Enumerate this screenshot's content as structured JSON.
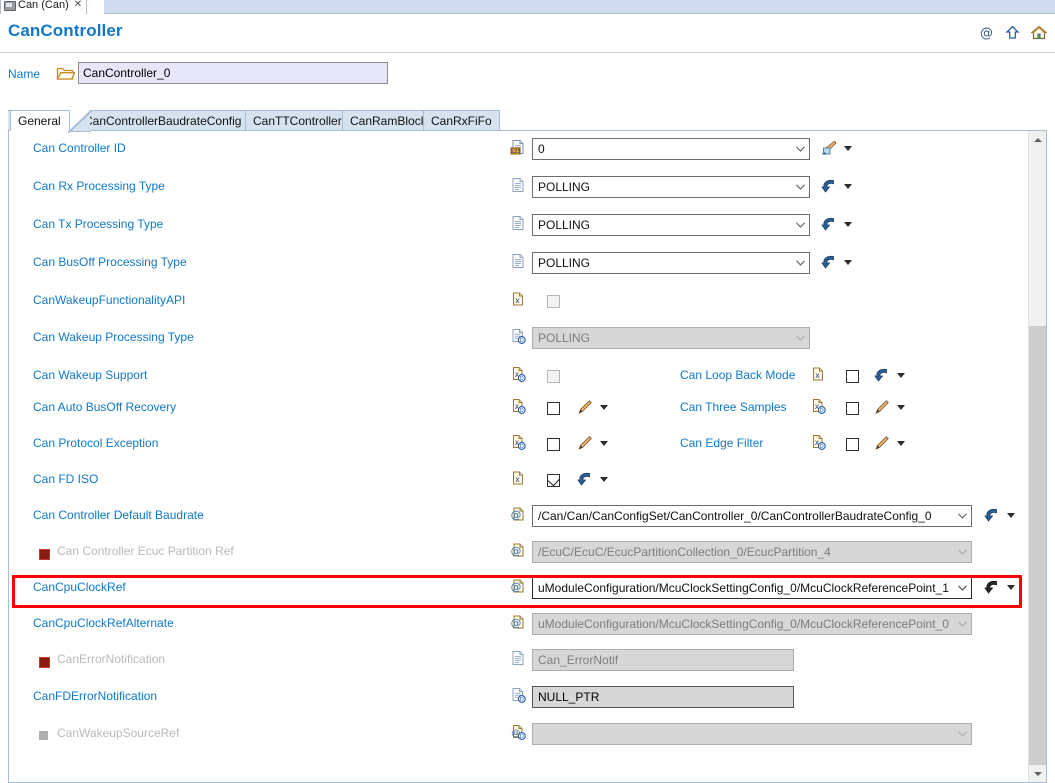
{
  "editor_tab": {
    "label": "Can (Can)",
    "close": "✕"
  },
  "header": {
    "title": "CanController",
    "icons": [
      "at-icon",
      "up-arrow-icon",
      "home-icon"
    ]
  },
  "name_row": {
    "label": "Name",
    "folder_icon": "folder-icon",
    "value": "CanController_0"
  },
  "tabs": [
    {
      "label": "General",
      "active": true
    },
    {
      "label": "CanControllerBaudrateConfig",
      "active": false
    },
    {
      "label": "CanTTController",
      "active": false
    },
    {
      "label": "CanRamBlock",
      "active": false
    },
    {
      "label": "CanRxFiFo",
      "active": false
    }
  ],
  "rows": [
    {
      "label": "Can Controller ID",
      "icon": "doc-numeric-icon",
      "control": "combo",
      "value": "0",
      "disabled": false,
      "action_icon": "paint-icon",
      "caret": true
    },
    {
      "label": "Can Rx Processing Type",
      "icon": "doc-icon",
      "control": "combo",
      "value": "POLLING",
      "disabled": false,
      "action_icon": "blue-arrow-icon",
      "caret": true
    },
    {
      "label": "Can Tx Processing Type",
      "icon": "doc-icon",
      "control": "combo",
      "value": "POLLING",
      "disabled": false,
      "action_icon": "blue-arrow-icon",
      "caret": true
    },
    {
      "label": "Can BusOff Processing Type",
      "icon": "doc-icon",
      "control": "combo",
      "value": "POLLING",
      "disabled": false,
      "action_icon": "blue-arrow-icon",
      "caret": true
    },
    {
      "label": "CanWakeupFunctionalityAPI",
      "icon": "doc-x-icon",
      "control": "checkbox",
      "checked": false,
      "disabled": true,
      "action_icon": null,
      "caret": false
    },
    {
      "label": "Can Wakeup Processing Type",
      "icon": "doc-derived-icon",
      "control": "combo",
      "value": "POLLING",
      "disabled": true,
      "action_icon": null,
      "caret": false
    },
    {
      "label": "Can Wakeup Support",
      "icon": "doc-x-derived-icon",
      "control": "checkbox",
      "checked": false,
      "disabled": true,
      "action_icon": null,
      "caret": false,
      "second": {
        "label": "Can Loop Back Mode",
        "icon": "doc-x-icon",
        "checked": false,
        "disabled": false,
        "action_icon": "blue-arrow-icon",
        "caret": true
      }
    },
    {
      "label": "Can Auto BusOff Recovery",
      "icon": "doc-x-derived-icon",
      "control": "checkbox",
      "checked": false,
      "disabled": false,
      "action_icon": "pencil-icon",
      "caret": true,
      "second": {
        "label": "Can Three Samples",
        "icon": "doc-x-derived-icon",
        "checked": false,
        "disabled": false,
        "action_icon": "pencil-icon",
        "caret": true
      }
    },
    {
      "label": "Can Protocol Exception",
      "icon": "doc-x-derived-icon",
      "control": "checkbox",
      "checked": false,
      "disabled": false,
      "action_icon": "pencil-icon",
      "caret": true,
      "second": {
        "label": "Can Edge Filter",
        "icon": "doc-x-derived-icon",
        "checked": false,
        "disabled": false,
        "action_icon": "pencil-icon",
        "caret": true
      }
    },
    {
      "label": "Can FD ISO",
      "icon": "doc-x-icon",
      "control": "checkbox",
      "checked": true,
      "disabled": false,
      "action_icon": "blue-arrow-icon",
      "caret": true
    },
    {
      "label": "Can Controller Default Baudrate",
      "icon": "at-doc-icon",
      "control": "combo-wide",
      "value": "/Can/Can/CanConfigSet/CanController_0/CanControllerBaudrateConfig_0",
      "disabled": false,
      "action_icon": "blue-arrow-icon",
      "caret": true
    },
    {
      "label": "Can Controller Ecuc Partition Ref",
      "bullet": "red",
      "icon": "at-doc-icon",
      "control": "combo-wide",
      "value": "/EcuC/EcuC/EcucPartitionCollection_0/EcucPartition_4",
      "disabled": true,
      "dim_label": true,
      "action_icon": null,
      "caret": false
    },
    {
      "label": "CanCpuClockRef",
      "icon": "at-doc-icon",
      "control": "combo-wide",
      "value": "uModuleConfiguration/McuClockSettingConfig_0/McuClockReferencePoint_1",
      "disabled": false,
      "highlighted": true,
      "action_icon": "blue-arrow-icon",
      "caret": true
    },
    {
      "label": "CanCpuClockRefAlternate",
      "icon": "at-doc-icon",
      "control": "combo-wide",
      "value": "uModuleConfiguration/McuClockSettingConfig_0/McuClockReferencePoint_0",
      "disabled": true,
      "action_icon": null,
      "caret": false
    },
    {
      "label": "CanErrorNotification",
      "bullet": "red",
      "icon": "doc-icon",
      "control": "text",
      "value": "Can_ErrorNotif",
      "disabled": true,
      "dim_label": true,
      "action_icon": null,
      "caret": false
    },
    {
      "label": "CanFDErrorNotification",
      "icon": "doc-derived-icon",
      "control": "text",
      "value": "NULL_PTR",
      "disabled": false,
      "action_icon": null,
      "caret": false
    },
    {
      "label": "CanWakeupSourceRef",
      "bullet": "gray",
      "icon": "at-doc-derived-icon",
      "control": "combo-wide",
      "value": "",
      "disabled": true,
      "dim_label": true,
      "action_icon": null,
      "caret": false
    }
  ],
  "colors": {
    "link_blue": "#1178c8",
    "highlight_red": "#ff0000",
    "name_field_bg": "#e8e6fb",
    "tab_inactive_bg": "#d6e2f0"
  },
  "scrollbar": {
    "up": "chevron-up-icon",
    "down": "chevron-down-icon"
  }
}
